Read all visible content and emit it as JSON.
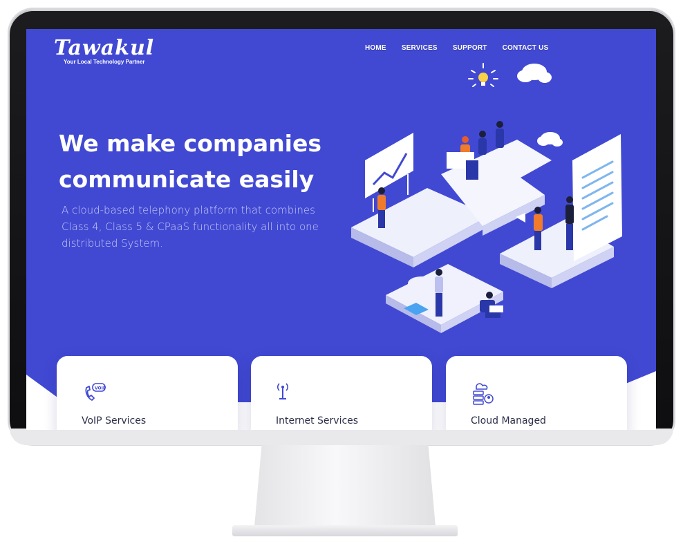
{
  "brand": {
    "name": "Tawakul",
    "tagline": "Your Local Technology Partner"
  },
  "nav": {
    "items": [
      {
        "label": "HOME"
      },
      {
        "label": "SERVICES"
      },
      {
        "label": "SUPPORT"
      },
      {
        "label": "CONTACT US"
      }
    ]
  },
  "hero": {
    "title_line1": "We make companies",
    "title_line2": "communicate easily",
    "subtitle": "A cloud-based telephony platform that combines Class 4, Class 5 & CPaaS functionality all into one distributed System."
  },
  "services": {
    "cards": [
      {
        "title": "VoIP Services",
        "icon": "voip-phone-icon"
      },
      {
        "title": "Internet Services",
        "icon": "antenna-icon"
      },
      {
        "title": "Cloud Managed",
        "icon": "cloud-server-icon"
      }
    ]
  },
  "theme": {
    "primary": "#4149d3",
    "accent_orange": "#f07c2b",
    "text_dark": "#2c2f4a"
  }
}
